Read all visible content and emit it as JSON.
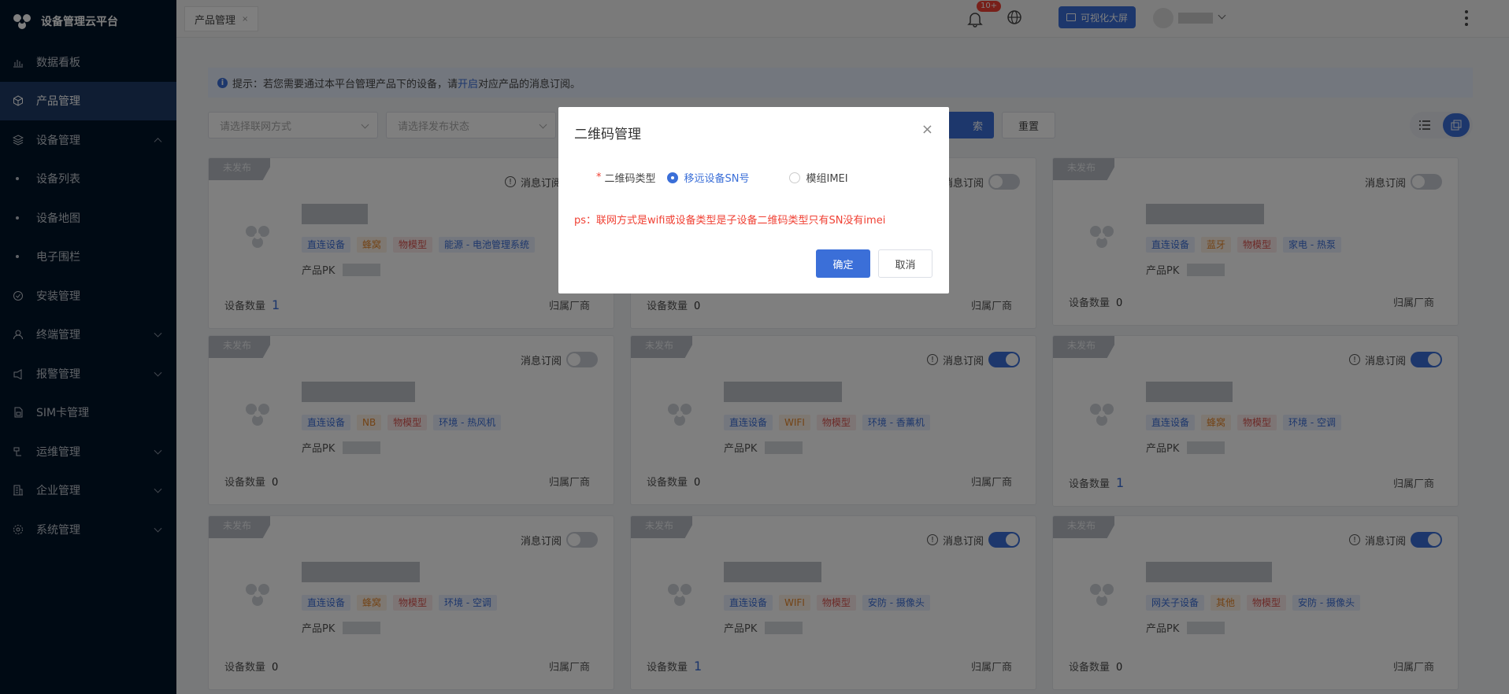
{
  "app": {
    "title": "设备管理云平台"
  },
  "sidebar": {
    "items": [
      {
        "label": "数据看板",
        "icon": "bar-chart-icon"
      },
      {
        "label": "产品管理",
        "icon": "cube-icon"
      },
      {
        "label": "设备管理",
        "icon": "layers-icon"
      },
      {
        "label": "设备列表"
      },
      {
        "label": "设备地图"
      },
      {
        "label": "电子围栏"
      },
      {
        "label": "安装管理",
        "icon": "check-circle-icon"
      },
      {
        "label": "终端管理",
        "icon": "user-icon"
      },
      {
        "label": "报警管理",
        "icon": "alarm-icon"
      },
      {
        "label": "SIM卡管理",
        "icon": "sim-icon"
      },
      {
        "label": "运维管理",
        "icon": "tool-icon"
      },
      {
        "label": "企业管理",
        "icon": "building-icon"
      },
      {
        "label": "系统管理",
        "icon": "gear-icon"
      }
    ]
  },
  "topbar": {
    "tab_label": "产品管理",
    "tab_close": "×",
    "notification_badge": "10+",
    "bigscreen_label": "可视化大屏"
  },
  "notice": {
    "prefix": "提示：若您需要通过本平台管理产品下的设备，请",
    "link": "开启",
    "suffix": "对应产品的消息订阅。"
  },
  "filters": {
    "network_placeholder": "请选择联网方式",
    "status_placeholder": "请选择发布状态",
    "search_label": "索",
    "reset_label": "重置"
  },
  "card_labels": {
    "ribbon": "未发布",
    "subscribe": "消息订阅",
    "pk": "产品PK",
    "count": "设备数量",
    "vendor": "归属厂商"
  },
  "cards": [
    {
      "tags": [
        {
          "t": "直连设备",
          "c": "blue"
        },
        {
          "t": "蜂窝",
          "c": "orange"
        },
        {
          "t": "物模型",
          "c": "red"
        },
        {
          "t": "能源 - 电池管理系统",
          "c": "blue"
        }
      ],
      "count": "1",
      "subscribed": false
    },
    {
      "tags": [],
      "count": "0",
      "subscribed": false
    },
    {
      "tags": [
        {
          "t": "直连设备",
          "c": "blue"
        },
        {
          "t": "蓝牙",
          "c": "orange"
        },
        {
          "t": "物模型",
          "c": "red"
        },
        {
          "t": "家电 - 热泵",
          "c": "blue"
        }
      ],
      "count": "0",
      "subscribed": false
    },
    {
      "tags": [
        {
          "t": "直连设备",
          "c": "blue"
        },
        {
          "t": "NB",
          "c": "orange"
        },
        {
          "t": "物模型",
          "c": "red"
        },
        {
          "t": "环境 - 热风机",
          "c": "blue"
        }
      ],
      "count": "0",
      "subscribed": false
    },
    {
      "tags": [
        {
          "t": "直连设备",
          "c": "blue"
        },
        {
          "t": "WIFI",
          "c": "orange"
        },
        {
          "t": "物模型",
          "c": "red"
        },
        {
          "t": "环境 - 香薰机",
          "c": "blue"
        }
      ],
      "count": "0",
      "subscribed": true
    },
    {
      "tags": [
        {
          "t": "直连设备",
          "c": "blue"
        },
        {
          "t": "蜂窝",
          "c": "orange"
        },
        {
          "t": "物模型",
          "c": "red"
        },
        {
          "t": "环境 - 空调",
          "c": "blue"
        }
      ],
      "count": "1",
      "subscribed": true
    },
    {
      "tags": [
        {
          "t": "直连设备",
          "c": "blue"
        },
        {
          "t": "蜂窝",
          "c": "orange"
        },
        {
          "t": "物模型",
          "c": "red"
        },
        {
          "t": "环境 - 空调",
          "c": "blue"
        }
      ],
      "count": "0",
      "subscribed": false
    },
    {
      "tags": [
        {
          "t": "直连设备",
          "c": "blue"
        },
        {
          "t": "WIFI",
          "c": "orange"
        },
        {
          "t": "物模型",
          "c": "red"
        },
        {
          "t": "安防 - 摄像头",
          "c": "blue"
        }
      ],
      "count": "1",
      "subscribed": true
    },
    {
      "tags": [
        {
          "t": "网关子设备",
          "c": "blue"
        },
        {
          "t": "其他",
          "c": "orange"
        },
        {
          "t": "物模型",
          "c": "red"
        },
        {
          "t": "安防 - 摄像头",
          "c": "blue"
        }
      ],
      "count": "0",
      "subscribed": true
    }
  ],
  "modal": {
    "title": "二维码管理",
    "close": "×",
    "required_mark": "*",
    "field_label": "二维码类型",
    "option_sn": "移远设备SN号",
    "option_imei": "模组IMEI",
    "selected": "option_sn",
    "hint": "ps：联网方式是wifi或设备类型是子设备二维码类型只有SN没有imei",
    "ok_label": "确定",
    "cancel_label": "取消"
  },
  "colors": {
    "primary": "#3b6fd8",
    "sidebar_bg": "#001529",
    "danger": "#f04134"
  }
}
